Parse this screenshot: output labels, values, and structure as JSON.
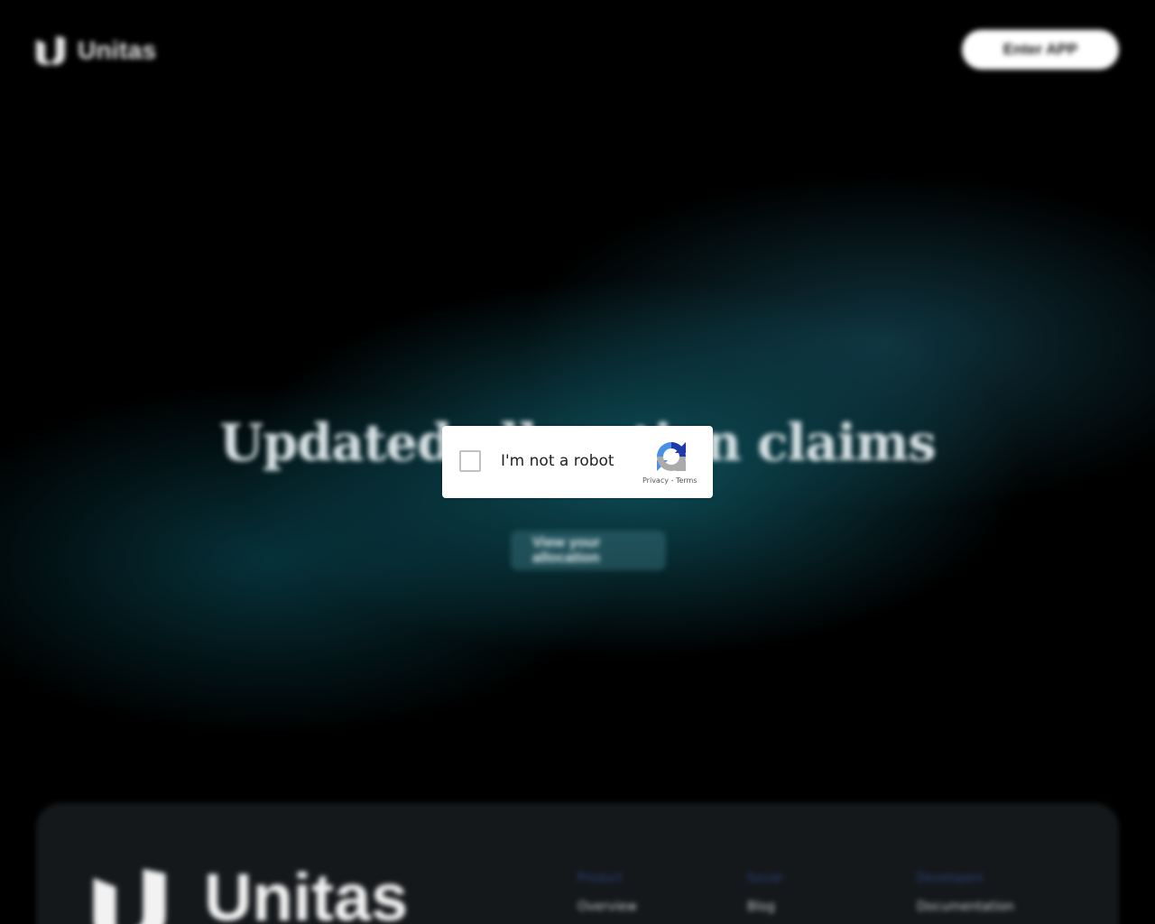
{
  "header": {
    "logo_text": "Unitas",
    "enter_app_label": "Enter APP"
  },
  "hero": {
    "title": "Updated allocation claims",
    "subtitle": "",
    "cta_label": "View your allocation"
  },
  "footer": {
    "logo_text": "Unitas",
    "columns": [
      {
        "heading": "Product",
        "link": "Overview"
      },
      {
        "heading": "Social",
        "link": "Blog"
      },
      {
        "heading": "Developers",
        "link": "Documentation"
      }
    ]
  },
  "recaptcha": {
    "label": "I'm not a robot",
    "privacy": "Privacy",
    "separator": "-",
    "terms": "Terms"
  }
}
